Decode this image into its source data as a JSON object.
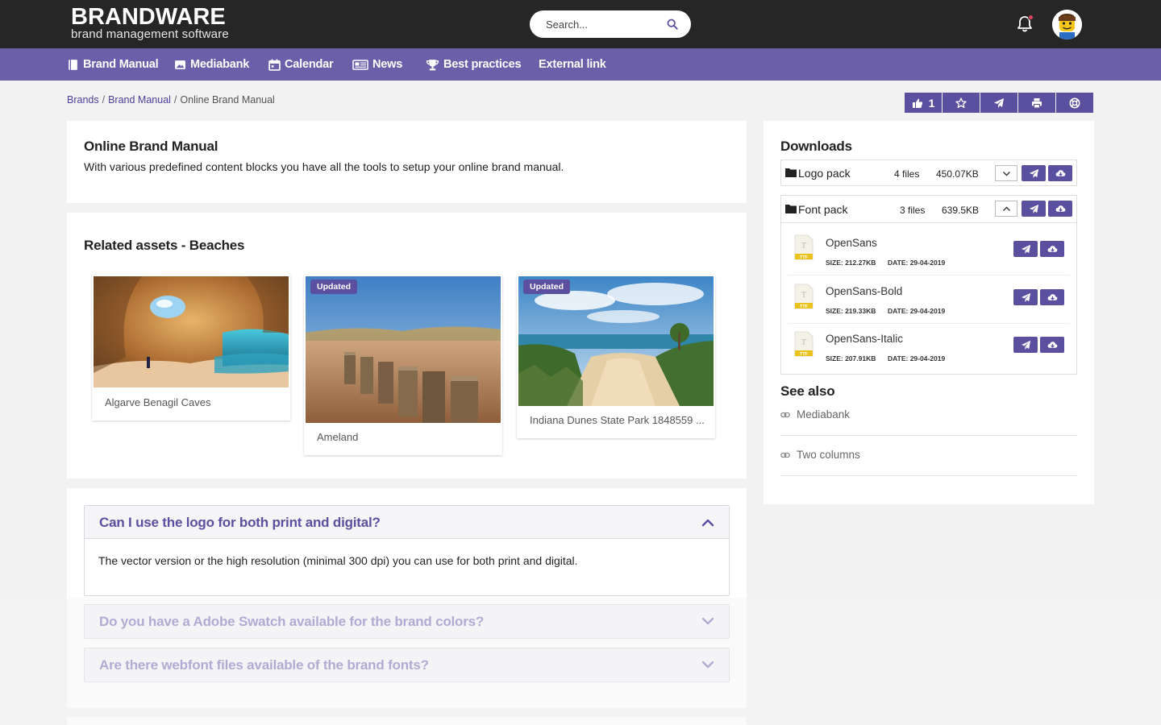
{
  "header": {
    "logo_title": "BRANDWARE",
    "logo_subtitle": "brand management software",
    "search_placeholder": "Search...",
    "colors": {
      "topbar": "#262626",
      "nav": "#6a5fa8",
      "accent": "#5b4fa0",
      "notification": "#e0435c"
    }
  },
  "nav": {
    "items": [
      {
        "label": "Brand Manual",
        "icon": "book-icon"
      },
      {
        "label": "Mediabank",
        "icon": "image-icon"
      },
      {
        "label": "Calendar",
        "icon": "calendar-icon"
      },
      {
        "label": "News",
        "icon": "newspaper-icon"
      },
      {
        "label": "Best practices",
        "icon": "trophy-icon"
      },
      {
        "label": "External link",
        "icon": ""
      }
    ]
  },
  "breadcrumb": {
    "items": [
      "Brands",
      "Brand Manual"
    ],
    "current": "Online Brand Manual",
    "separator": "/"
  },
  "actions": {
    "like_count": "1"
  },
  "intro": {
    "title": "Online Brand Manual",
    "text": "With various predefined content blocks you have all the tools to setup your online brand manual."
  },
  "related": {
    "title": "Related assets - Beaches",
    "assets": [
      {
        "caption": "Algarve Benagil Caves",
        "badge": ""
      },
      {
        "caption": "Ameland",
        "badge": "Updated"
      },
      {
        "caption": "Indiana Dunes State Park 1848559 ...",
        "badge": "Updated"
      }
    ]
  },
  "faq": {
    "items": [
      {
        "question": "Can I use the logo for both print and digital?",
        "answer": "The vector version or the high resolution (minimal 300 dpi) you can use for both print and digital.",
        "expanded": true
      },
      {
        "question": "Do you have a Adobe Swatch available for the brand colors?",
        "expanded": false
      },
      {
        "question": "Are there webfont files available of the brand fonts?",
        "expanded": false
      }
    ]
  },
  "downloads": {
    "title": "Downloads",
    "packs": [
      {
        "name": "Logo pack",
        "files": "4 files",
        "size": "450.07KB",
        "expanded": false
      },
      {
        "name": "Font pack",
        "files": "3 files",
        "size": "639.5KB",
        "expanded": true
      }
    ],
    "font_files": [
      {
        "name": "OpenSans",
        "size": "SIZE: 212.27KB",
        "date": "DATE: 29-04-2019",
        "type": "TTF"
      },
      {
        "name": "OpenSans-Bold",
        "size": "SIZE: 219.33KB",
        "date": "DATE: 29-04-2019",
        "type": "TTF"
      },
      {
        "name": "OpenSans-Italic",
        "size": "SIZE: 207.91KB",
        "date": "DATE: 29-04-2019",
        "type": "TTF"
      }
    ]
  },
  "see_also": {
    "title": "See also",
    "links": [
      "Mediabank",
      "Two columns"
    ]
  }
}
